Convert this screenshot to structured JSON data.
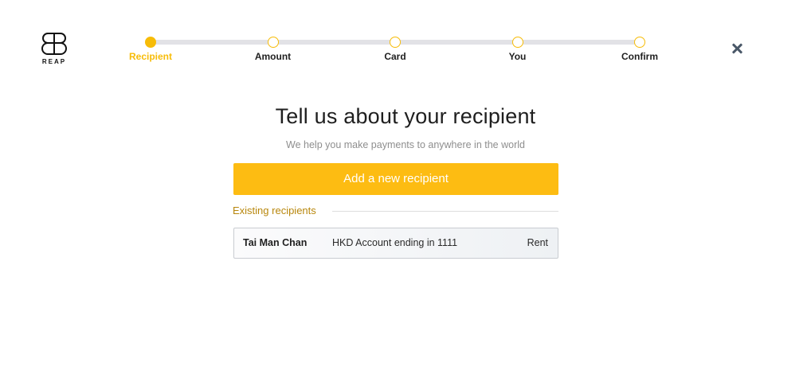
{
  "brand": {
    "name": "REAP",
    "accent": "#f7bc08",
    "button_color": "#fdbc12"
  },
  "stepper": {
    "steps": [
      {
        "label": "Recipient",
        "state": "active"
      },
      {
        "label": "Amount",
        "state": "pending"
      },
      {
        "label": "Card",
        "state": "pending"
      },
      {
        "label": "You",
        "state": "pending"
      },
      {
        "label": "Confirm",
        "state": "pending"
      }
    ]
  },
  "close": {
    "icon": "close-icon"
  },
  "main": {
    "title": "Tell us about your recipient",
    "subtitle": "We help you make payments to anywhere in the world",
    "add_button_label": "Add a new recipient",
    "existing_label": "Existing recipients",
    "recipients": [
      {
        "name": "Tai Man Chan",
        "account": "HKD Account ending in 1111",
        "tag": "Rent"
      }
    ]
  }
}
